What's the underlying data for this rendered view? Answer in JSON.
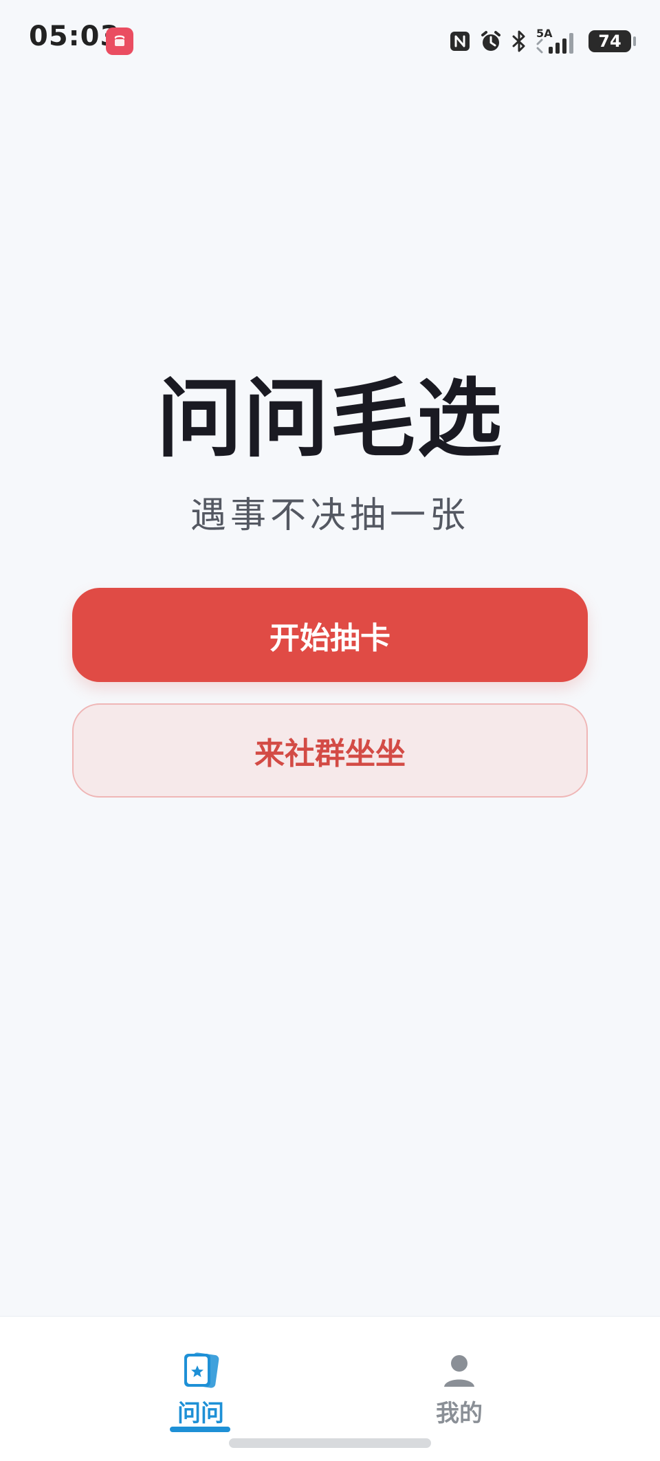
{
  "status_bar": {
    "time": "05:03",
    "app_badge": "App Gallery",
    "icons": [
      "nfc-icon",
      "alarm-icon",
      "bluetooth-icon",
      "signal-icon"
    ],
    "signal_label": "5A",
    "battery": "74"
  },
  "hero": {
    "title": "问问毛选",
    "subtitle": "遇事不决抽一张"
  },
  "buttons": {
    "primary": "开始抽卡",
    "secondary": "来社群坐坐"
  },
  "bottom_nav": {
    "items": [
      {
        "label": "问问",
        "icon": "card-icon",
        "active": true
      },
      {
        "label": "我的",
        "icon": "user-icon",
        "active": false
      }
    ]
  },
  "colors": {
    "primary": "#e04b45",
    "secondary_bg": "#f6e9ea",
    "secondary_border": "#efb6b6",
    "active_nav": "#1e90d6"
  }
}
